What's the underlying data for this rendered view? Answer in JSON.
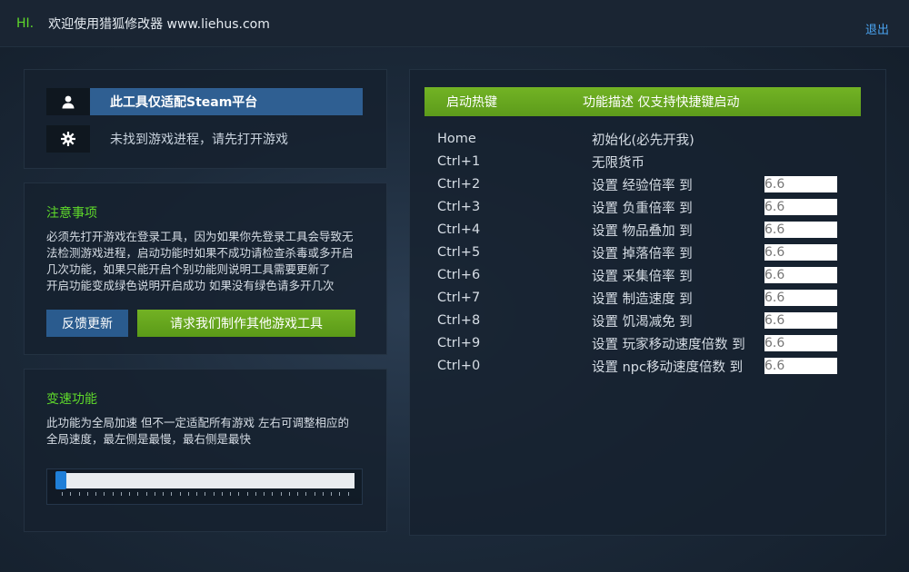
{
  "header": {
    "hi": "HI.",
    "welcome": "欢迎使用猎狐修改器 www.liehus.com",
    "logout": "退出"
  },
  "status": {
    "platform_label": "此工具仅适配Steam平台",
    "process_label": "未找到游戏进程，请先打开游戏",
    "user_icon": "user-icon",
    "gear_icon": "gear-icon"
  },
  "notice": {
    "title": "注意事项",
    "lines": [
      "必须先打开游戏在登录工具，因为如果你先登录工具会导致无",
      "法检测游戏进程，启动功能时如果不成功请检查杀毒或多开启",
      "几次功能，如果只能开启个别功能则说明工具需要更新了",
      "开启功能变成绿色说明开启成功 如果没有绿色请多开几次"
    ],
    "feedback_button": "反馈更新",
    "request_button": "请求我们制作其他游戏工具"
  },
  "speed": {
    "title": "变速功能",
    "lines": [
      "此功能为全局加速 但不一定适配所有游戏 左右可调整相应的",
      "全局速度，最左侧是最慢，最右侧是最快"
    ],
    "value": 0
  },
  "hotkeys": {
    "header_key": "启动热键",
    "header_desc": "功能描述 仅支持快捷键启动",
    "rows": [
      {
        "key": "Home",
        "desc": "初始化(必先开我)",
        "value": null
      },
      {
        "key": "Ctrl+1",
        "desc": "无限货币",
        "value": null
      },
      {
        "key": "Ctrl+2",
        "desc": "设置 经验倍率 到",
        "value": "6.6"
      },
      {
        "key": "Ctrl+3",
        "desc": "设置 负重倍率 到",
        "value": "6.6"
      },
      {
        "key": "Ctrl+4",
        "desc": "设置 物品叠加 到",
        "value": "6.6"
      },
      {
        "key": "Ctrl+5",
        "desc": "设置 掉落倍率 到",
        "value": "6.6"
      },
      {
        "key": "Ctrl+6",
        "desc": "设置 采集倍率 到",
        "value": "6.6"
      },
      {
        "key": "Ctrl+7",
        "desc": "设置 制造速度 到",
        "value": "6.6"
      },
      {
        "key": "Ctrl+8",
        "desc": "设置 饥渴减免 到",
        "value": "6.6"
      },
      {
        "key": "Ctrl+9",
        "desc": "设置 玩家移动速度倍数 到",
        "value": "6.6"
      },
      {
        "key": "Ctrl+0",
        "desc": "设置 npc移动速度倍数 到",
        "value": "6.6"
      }
    ]
  }
}
